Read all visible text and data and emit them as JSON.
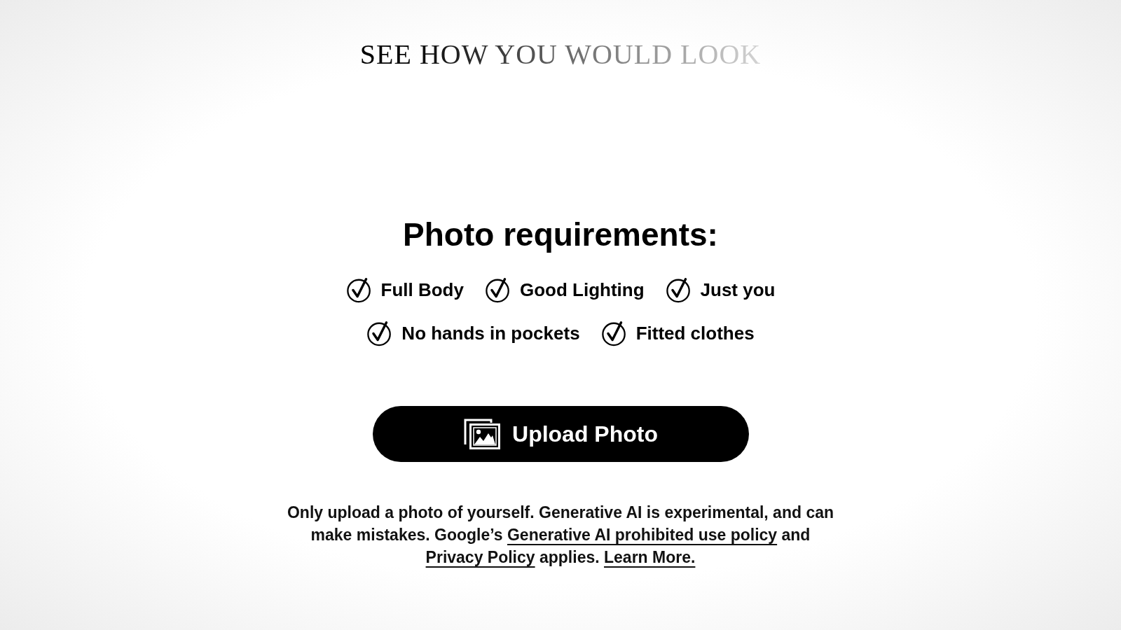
{
  "title": "SEE HOW YOU WOULD LOOK",
  "requirements": {
    "heading": "Photo requirements:",
    "items": [
      "Full Body",
      "Good Lighting",
      "Just you",
      "No hands in pockets",
      "Fitted clothes"
    ]
  },
  "upload_button": {
    "label": "Upload Photo"
  },
  "disclaimer": [
    {
      "kind": "text",
      "text": "Only upload a photo of yourself. Generative AI is experimental, and can make mistakes. Google’s "
    },
    {
      "kind": "link",
      "text": "Generative AI prohibited use policy"
    },
    {
      "kind": "text",
      "text": " and "
    },
    {
      "kind": "link",
      "text": "Privacy Policy"
    },
    {
      "kind": "text",
      "text": " applies. "
    },
    {
      "kind": "link",
      "text": "Learn More."
    }
  ]
}
